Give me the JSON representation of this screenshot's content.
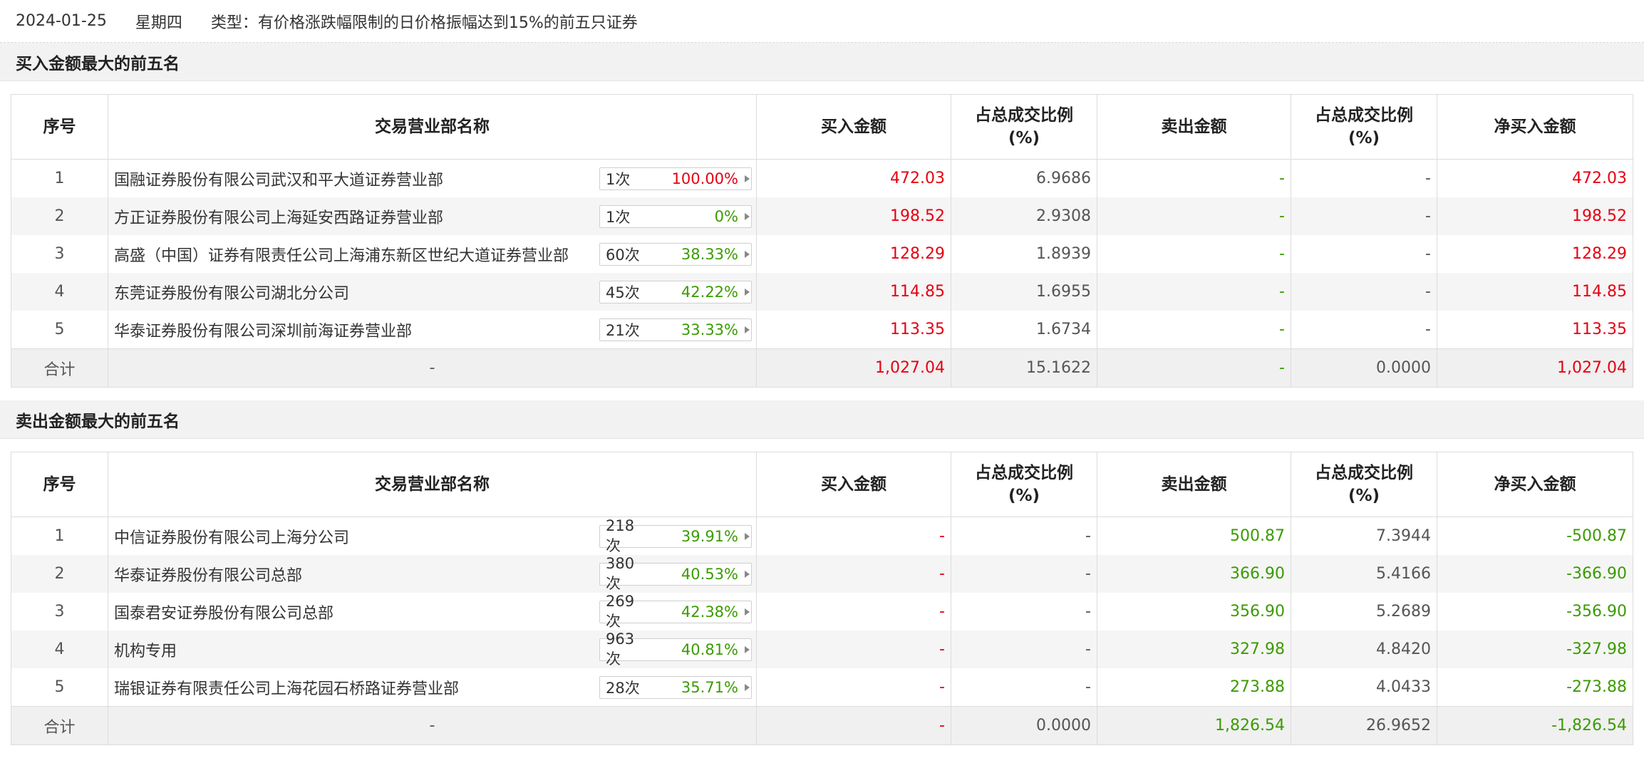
{
  "header": {
    "date": "2024-01-25",
    "weekday": "星期四",
    "type_text": "类型：有价格涨跌幅限制的日价格振幅达到15%的前五只证券"
  },
  "columns": {
    "seq": "序号",
    "name": "交易营业部名称",
    "buy": "买入金额",
    "buy_ratio_1": "占总成交比例",
    "buy_ratio_2": "(%)",
    "sell": "卖出金额",
    "sell_ratio_1": "占总成交比例",
    "sell_ratio_2": "(%)",
    "net": "净买入金额"
  },
  "buy_section": {
    "title": "买入金额最大的前五名",
    "rows": [
      {
        "seq": "1",
        "name": "国融证券股份有限公司武汉和平大道证券营业部",
        "count": "1次",
        "rate": "100.00%",
        "rate_color": "red",
        "buy": "472.03",
        "buy_ratio": "6.9686",
        "sell": "-",
        "sell_ratio": "-",
        "net": "472.03"
      },
      {
        "seq": "2",
        "name": "方正证券股份有限公司上海延安西路证券营业部",
        "count": "1次",
        "rate": "0%",
        "rate_color": "green",
        "buy": "198.52",
        "buy_ratio": "2.9308",
        "sell": "-",
        "sell_ratio": "-",
        "net": "198.52"
      },
      {
        "seq": "3",
        "name": "高盛（中国）证券有限责任公司上海浦东新区世纪大道证券营业部",
        "count": "60次",
        "rate": "38.33%",
        "rate_color": "green",
        "buy": "128.29",
        "buy_ratio": "1.8939",
        "sell": "-",
        "sell_ratio": "-",
        "net": "128.29"
      },
      {
        "seq": "4",
        "name": "东莞证券股份有限公司湖北分公司",
        "count": "45次",
        "rate": "42.22%",
        "rate_color": "green",
        "buy": "114.85",
        "buy_ratio": "1.6955",
        "sell": "-",
        "sell_ratio": "-",
        "net": "114.85"
      },
      {
        "seq": "5",
        "name": "华泰证券股份有限公司深圳前海证券营业部",
        "count": "21次",
        "rate": "33.33%",
        "rate_color": "green",
        "buy": "113.35",
        "buy_ratio": "1.6734",
        "sell": "-",
        "sell_ratio": "-",
        "net": "113.35"
      }
    ],
    "total": {
      "label": "合计",
      "name": "-",
      "buy": "1,027.04",
      "buy_ratio": "15.1622",
      "sell": "-",
      "sell_ratio": "0.0000",
      "net": "1,027.04"
    }
  },
  "sell_section": {
    "title": "卖出金额最大的前五名",
    "rows": [
      {
        "seq": "1",
        "name": "中信证券股份有限公司上海分公司",
        "count": "218次",
        "rate": "39.91%",
        "rate_color": "green",
        "buy": "-",
        "buy_ratio": "-",
        "sell": "500.87",
        "sell_ratio": "7.3944",
        "net": "-500.87"
      },
      {
        "seq": "2",
        "name": "华泰证券股份有限公司总部",
        "count": "380次",
        "rate": "40.53%",
        "rate_color": "green",
        "buy": "-",
        "buy_ratio": "-",
        "sell": "366.90",
        "sell_ratio": "5.4166",
        "net": "-366.90"
      },
      {
        "seq": "3",
        "name": "国泰君安证券股份有限公司总部",
        "count": "269次",
        "rate": "42.38%",
        "rate_color": "green",
        "buy": "-",
        "buy_ratio": "-",
        "sell": "356.90",
        "sell_ratio": "5.2689",
        "net": "-356.90"
      },
      {
        "seq": "4",
        "name": "机构专用",
        "count": "963次",
        "rate": "40.81%",
        "rate_color": "green",
        "buy": "-",
        "buy_ratio": "-",
        "sell": "327.98",
        "sell_ratio": "4.8420",
        "net": "-327.98"
      },
      {
        "seq": "5",
        "name": "瑞银证券有限责任公司上海花园石桥路证券营业部",
        "count": "28次",
        "rate": "35.71%",
        "rate_color": "green",
        "buy": "-",
        "buy_ratio": "-",
        "sell": "273.88",
        "sell_ratio": "4.0433",
        "net": "-273.88"
      }
    ],
    "total": {
      "label": "合计",
      "name": "-",
      "buy": "-",
      "buy_ratio": "0.0000",
      "sell": "1,826.54",
      "sell_ratio": "26.9652",
      "net": "-1,826.54"
    }
  },
  "colors": {
    "red": "#e60012",
    "green": "#3a9b00"
  },
  "icons": {
    "badge_arrow": "caret-right-icon"
  }
}
